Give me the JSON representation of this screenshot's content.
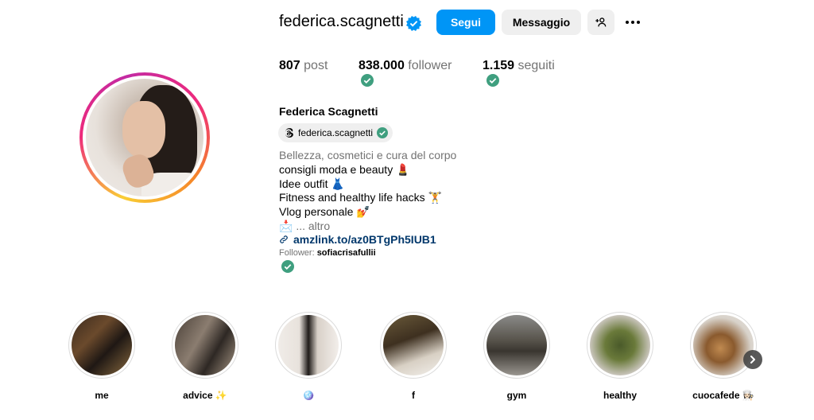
{
  "profile": {
    "username": "federica.scagnetti",
    "full_name": "Federica Scagnetti",
    "verified": true,
    "threads_handle": "federica.scagnetti"
  },
  "actions": {
    "follow_label": "Segui",
    "message_label": "Messaggio"
  },
  "stats": {
    "posts_count": "807",
    "posts_label": "post",
    "followers_count": "838.000",
    "followers_label": "follower",
    "following_count": "1.159",
    "following_label": "seguiti"
  },
  "bio": {
    "category": "Bellezza, cosmetici e cura del corpo",
    "lines": [
      "consigli moda e beauty 💄",
      "Idee outfit 👗",
      "Fitness and healthy life hacks 🏋",
      "Vlog personale 💅"
    ],
    "more_prefix": "📩",
    "more_label": "... altro",
    "link": "amzlink.to/az0BTgPh5IUB1",
    "followed_by_label": "Follower:",
    "followed_by_user": "sofiacrisafullii"
  },
  "highlights": [
    {
      "label": "me"
    },
    {
      "label": "advice ✨"
    },
    {
      "label": "🪩"
    },
    {
      "label": "f"
    },
    {
      "label": "gym"
    },
    {
      "label": "healthy"
    },
    {
      "label": "cuocafede 👩🏻‍🍳"
    }
  ],
  "colors": {
    "accent": "#0095f6",
    "verified": "#0095f6",
    "check_green": "#3f9f7f",
    "link": "#00376b",
    "muted": "#737373"
  }
}
